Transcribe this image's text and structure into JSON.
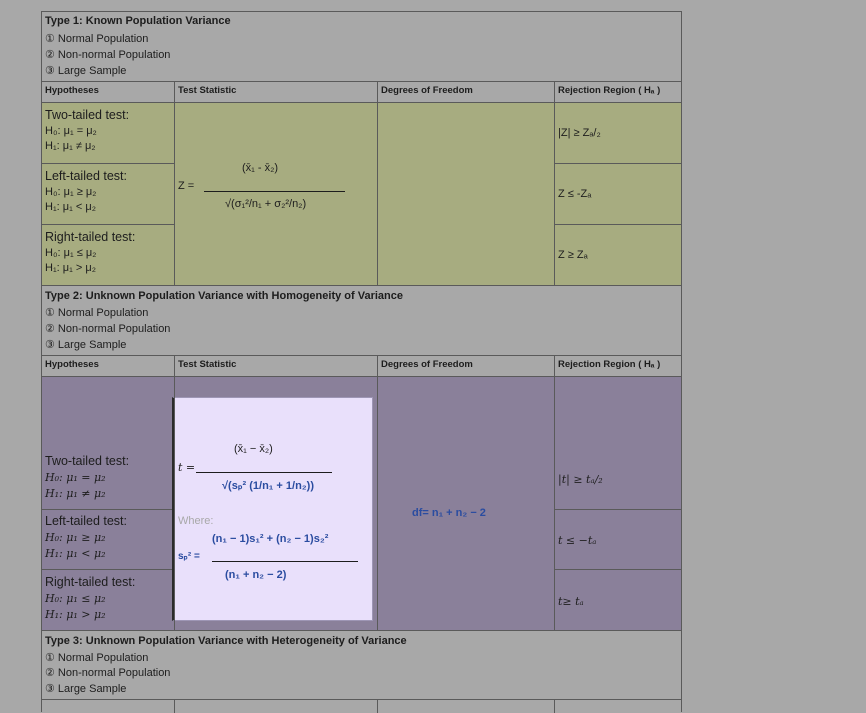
{
  "type1": {
    "title": "Type 1: Known Population Variance",
    "items": [
      "① Normal Population",
      "② Non-normal Population",
      "③ Large Sample"
    ]
  },
  "headers": {
    "hypotheses": "Hypotheses",
    "test_statistic": "Test Statistic",
    "degrees_of_freedom": "Degrees of Freedom",
    "rejection_region": "Rejection Region ( Hₐ )"
  },
  "type1_rows": [
    {
      "title": "Two-tailed test:",
      "h0": "H₀: μ₁ = μ₂",
      "h1": "H₁: μ₁ ≠ μ₂",
      "region": "|Z| ≥ Zₐ/₂"
    },
    {
      "title": "Left-tailed test:",
      "h0": "H₀: μ₁ ≥ μ₂",
      "h1": "H₁: μ₁ < μ₂",
      "region": "Z ≤ -Zₐ"
    },
    {
      "title": "Right-tailed test:",
      "h0": "H₀: μ₁ ≤ μ₂",
      "h1": "H₁: μ₁ > μ₂",
      "region": "Z ≥ Zₐ"
    }
  ],
  "type1_formula": {
    "lhs": "Z =",
    "numerator": "(x̄₁ - x̄₂)",
    "denominator": "√(σ₁²/n₁ + σ₂²/n₂)"
  },
  "type2": {
    "title": "Type 2: Unknown Population Variance with Homogeneity of Variance",
    "items": [
      "① Normal Population",
      "② Non-normal Population",
      "③ Large Sample"
    ]
  },
  "type2_rows": [
    {
      "title": "Two-tailed test:",
      "h0": "H₀: μ₁ = μ₂",
      "h1": "H₁: μ₁ ≠ μ₂",
      "region": "|t| ≥ tₐ/₂"
    },
    {
      "title": "Left-tailed test:",
      "h0": "H₀: μ₁ ≥ μ₂",
      "h1": "H₁: μ₁ < μ₂",
      "region": "t ≤ −tₐ"
    },
    {
      "title": "Right-tailed test:",
      "h0": "H₀: μ₁ ≤ μ₂",
      "h1": "H₁: μ₁ > μ₂",
      "region": "t≥ tₐ"
    }
  ],
  "type2_formula": {
    "lhs": "t =",
    "numerator": "(x̄₁ − x̄₂)",
    "denominator": "√(sₚ² (1/n₁ + 1/n₂))",
    "where": "Where:",
    "sp_lhs": "sₚ² =",
    "sp_numerator": "(n₁ − 1)s₁² + (n₂ − 1)s₂²",
    "sp_denominator": "(n₁ + n₂ − 2)"
  },
  "type2_df": "df= n₁ + n₂ − 2",
  "type3": {
    "title": "Type 3: Unknown Population Variance with Heterogeneity of Variance",
    "items": [
      "① Normal Population",
      "② Non-normal Population",
      "③ Large Sample"
    ]
  }
}
